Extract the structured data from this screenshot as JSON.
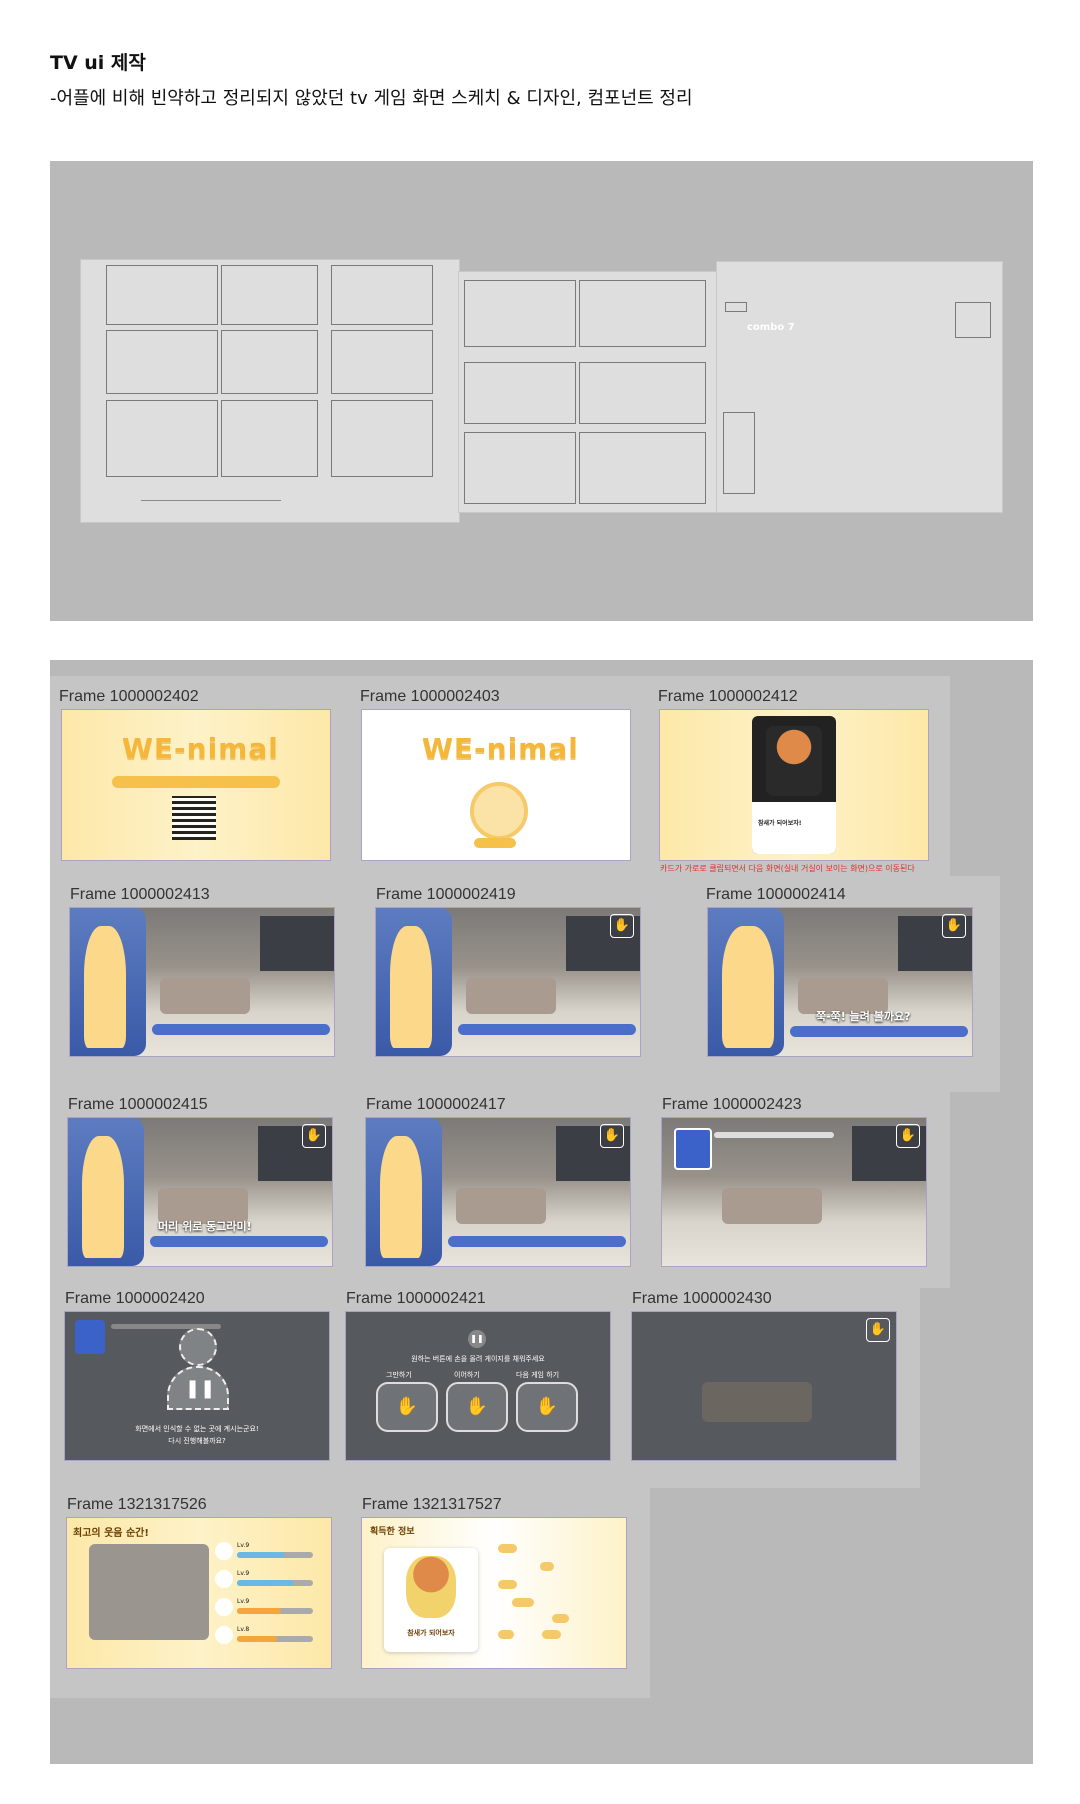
{
  "header": {
    "title": "TV ui 제작",
    "subtitle": "-어플에 비해 빈약하고 정리되지 않았던 tv 게임 화면 스케치 & 디자인, 컴포넌트 정리"
  },
  "sketch": {
    "combo_label": "combo 7"
  },
  "frames": [
    {
      "label": "Frame 1000002402"
    },
    {
      "label": "Frame 1000002403"
    },
    {
      "label": "Frame 1000002412"
    },
    {
      "label": "Frame 1000002413"
    },
    {
      "label": "Frame 1000002419"
    },
    {
      "label": "Frame 1000002414"
    },
    {
      "label": "Frame 1000002415"
    },
    {
      "label": "Frame 1000002417"
    },
    {
      "label": "Frame 1000002423"
    },
    {
      "label": "Frame 1000002420"
    },
    {
      "label": "Frame 1000002421"
    },
    {
      "label": "Frame 1000002430"
    },
    {
      "label": "Frame 1321317526"
    },
    {
      "label": "Frame 1321317527"
    }
  ],
  "screens": {
    "logo": "WE-nimal",
    "frame2412_note": "카드가 가로로 클립되면서 다음 화면(실내 거실이 보이는 화면)으로 이동된다",
    "frame2412_card_title": "참새가 되어보자!",
    "frame2414_caption": "쭉-쭉! 늘려 볼까요?",
    "frame2415_caption": "머리 위로 동그라미!",
    "frame2420_msg1": "화면에서 인식할 수 없는 곳에 계시는군요!",
    "frame2420_msg2": "다시 진행해볼까요?",
    "frame2421_prompt": "원하는 버튼에 손을 올려 게이지를 채워주세요",
    "frame2421_btn1": "그만하기",
    "frame2421_btn2": "이어하기",
    "frame2421_btn3": "다음 게임 하기",
    "frame1526_title": "최고의 웃음 순간!",
    "frame1526_levels": [
      "Lv.9",
      "Lv.9",
      "Lv.9",
      "Lv.8"
    ],
    "frame1527_title": "획득한 정보",
    "frame1527_card_caption": "참새가 되어보자"
  }
}
